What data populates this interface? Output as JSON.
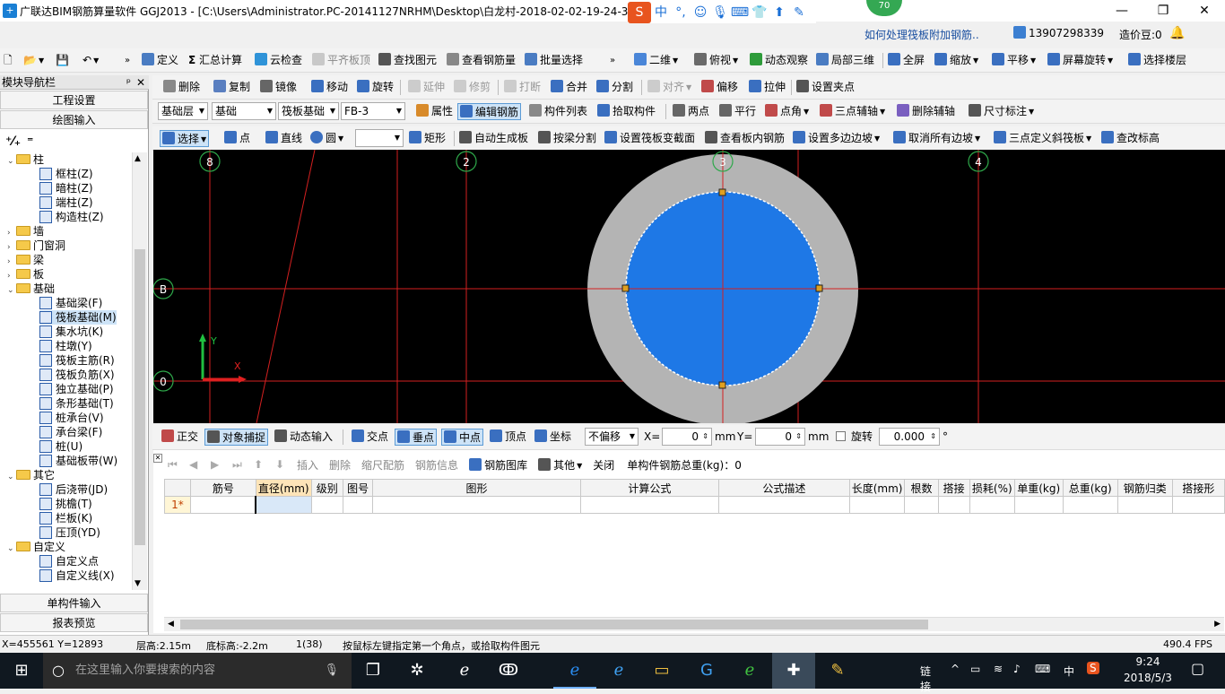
{
  "window": {
    "title": "广联达BIM钢筋算量软件 GGJ2013 - [C:\\Users\\Administrator.PC-20141127NRHM\\Desktop\\白龙村-2018-02-02-19-24-35",
    "badge": "70",
    "help_link": "如何处理筏板附加钢筋..",
    "phone": "13907298339",
    "price_beans": "造价豆:0",
    "ime_logo": "S",
    "ime_lang": "中"
  },
  "toolbar1": {
    "define": "定义",
    "sum": "汇总计算",
    "cloud_check": "云检查",
    "level_slab": "平齐板顶",
    "find": "查找图元",
    "view_rebar": "查看钢筋量",
    "batch_select": "批量选择",
    "view2d": "二维",
    "top_view": "俯视",
    "dynamic": "动态观察",
    "local3d": "局部三维",
    "fullscreen": "全屏",
    "zoom": "缩放",
    "pan": "平移",
    "screen_rotate": "屏幕旋转",
    "select_floor": "选择楼层"
  },
  "toolbar2": {
    "delete": "删除",
    "copy": "复制",
    "mirror": "镜像",
    "move": "移动",
    "rotate": "旋转",
    "extend": "延伸",
    "trim": "修剪",
    "break": "打断",
    "merge": "合并",
    "split": "分割",
    "align": "对齐",
    "offset": "偏移",
    "stretch": "拉伸",
    "set_grip": "设置夹点"
  },
  "toolbar3": {
    "layer_combo": "基础层",
    "type_combo": "基础",
    "category_combo": "筏板基础",
    "component_combo": "FB-3",
    "properties": "属性",
    "edit_rebar": "编辑钢筋",
    "component_list": "构件列表",
    "pick_component": "拾取构件",
    "two_points": "两点",
    "parallel": "平行",
    "point_angle": "点角",
    "three_point_axis": "三点辅轴",
    "delete_axis": "删除辅轴",
    "dimension": "尺寸标注"
  },
  "toolbar4": {
    "select": "选择",
    "point": "点",
    "line": "直线",
    "circle": "圆",
    "rect": "矩形",
    "auto_generate": "自动生成板",
    "split_by_beam": "按梁分割",
    "set_section": "设置筏板变截面",
    "view_inner_rebar": "查看板内钢筋",
    "set_slope": "设置多边边坡",
    "cancel_slope": "取消所有边坡",
    "three_point_slope": "三点定义斜筏板",
    "check_elevation": "查改标高"
  },
  "left_panel": {
    "title": "模块导航栏",
    "pin": "ᵖ",
    "project_settings": "工程设置",
    "drawing_input": "绘图输入",
    "tree": [
      {
        "label": "柱",
        "level": 0,
        "folder": true,
        "open": true
      },
      {
        "label": "框柱(Z)",
        "level": 1
      },
      {
        "label": "暗柱(Z)",
        "level": 1
      },
      {
        "label": "端柱(Z)",
        "level": 1
      },
      {
        "label": "构造柱(Z)",
        "level": 1
      },
      {
        "label": "墙",
        "level": 0,
        "folder": true,
        "open": false
      },
      {
        "label": "门窗洞",
        "level": 0,
        "folder": true,
        "open": false
      },
      {
        "label": "梁",
        "level": 0,
        "folder": true,
        "open": false
      },
      {
        "label": "板",
        "level": 0,
        "folder": true,
        "open": false
      },
      {
        "label": "基础",
        "level": 0,
        "folder": true,
        "open": true
      },
      {
        "label": "基础梁(F)",
        "level": 1
      },
      {
        "label": "筏板基础(M)",
        "level": 1,
        "selected": true
      },
      {
        "label": "集水坑(K)",
        "level": 1
      },
      {
        "label": "柱墩(Y)",
        "level": 1
      },
      {
        "label": "筏板主筋(R)",
        "level": 1
      },
      {
        "label": "筏板负筋(X)",
        "level": 1
      },
      {
        "label": "独立基础(P)",
        "level": 1
      },
      {
        "label": "条形基础(T)",
        "level": 1
      },
      {
        "label": "桩承台(V)",
        "level": 1
      },
      {
        "label": "承台梁(F)",
        "level": 1
      },
      {
        "label": "桩(U)",
        "level": 1
      },
      {
        "label": "基础板带(W)",
        "level": 1
      },
      {
        "label": "其它",
        "level": 0,
        "folder": true,
        "open": true
      },
      {
        "label": "后浇带(JD)",
        "level": 1
      },
      {
        "label": "挑檐(T)",
        "level": 1
      },
      {
        "label": "栏板(K)",
        "level": 1
      },
      {
        "label": "压顶(YD)",
        "level": 1
      },
      {
        "label": "自定义",
        "level": 0,
        "folder": true,
        "open": true
      },
      {
        "label": "自定义点",
        "level": 1
      },
      {
        "label": "自定义线(X)",
        "level": 1
      }
    ],
    "single_input": "单构件输入",
    "report_preview": "报表预览"
  },
  "canvas": {
    "axis_labels": [
      "8",
      "2",
      "3",
      "4",
      "B",
      "0"
    ],
    "y_axis": "Y",
    "x_axis": "X",
    "colors": {
      "bg": "#000000",
      "grid": "#d42020",
      "ring": "#b4b4b4",
      "fill": "#1e78e6"
    }
  },
  "snapbar": {
    "ortho": "正交",
    "object_snap": "对象捕捉",
    "dynamic_input": "动态输入",
    "intersection": "交点",
    "perpendicular": "垂点",
    "midpoint": "中点",
    "vertex": "顶点",
    "coord": "坐标",
    "offset_mode": "不偏移",
    "x_label": "X=",
    "x_value": "0",
    "y_label": "Y=",
    "y_value": "0",
    "unit": "mm",
    "rotate": "旋转",
    "rotate_value": "0.000",
    "degree": "°"
  },
  "gridbar": {
    "insert": "插入",
    "delete": "删除",
    "scale_config": "缩尺配筋",
    "rebar_info": "钢筋信息",
    "rebar_library": "钢筋图库",
    "other": "其他",
    "close": "关闭",
    "total_weight": "单构件钢筋总重(kg)：0"
  },
  "grid": {
    "headers": [
      "",
      "筋号",
      "直径(mm)",
      "级别",
      "图号",
      "图形",
      "计算公式",
      "公式描述",
      "长度(mm)",
      "根数",
      "搭接",
      "损耗(%)",
      "单重(kg)",
      "总重(kg)",
      "钢筋归类",
      "搭接形"
    ],
    "row": [
      "1*",
      "",
      "",
      "",
      "",
      "",
      "",
      "",
      "",
      "",
      "",
      "",
      "",
      "",
      "",
      ""
    ]
  },
  "status": {
    "coords": "X=455561 Y=12893",
    "floor_height": "层高:2.15m",
    "bottom_elev": "底标高:-2.2m",
    "count": "1(38)",
    "hint": "按鼠标左键指定第一个角点，或拾取构件图元",
    "fps": "490.4 FPS"
  },
  "taskbar": {
    "search_placeholder": "在这里输入你要搜索的内容",
    "link": "链接",
    "lang": "中",
    "time": "9:24",
    "date": "2018/5/3"
  }
}
